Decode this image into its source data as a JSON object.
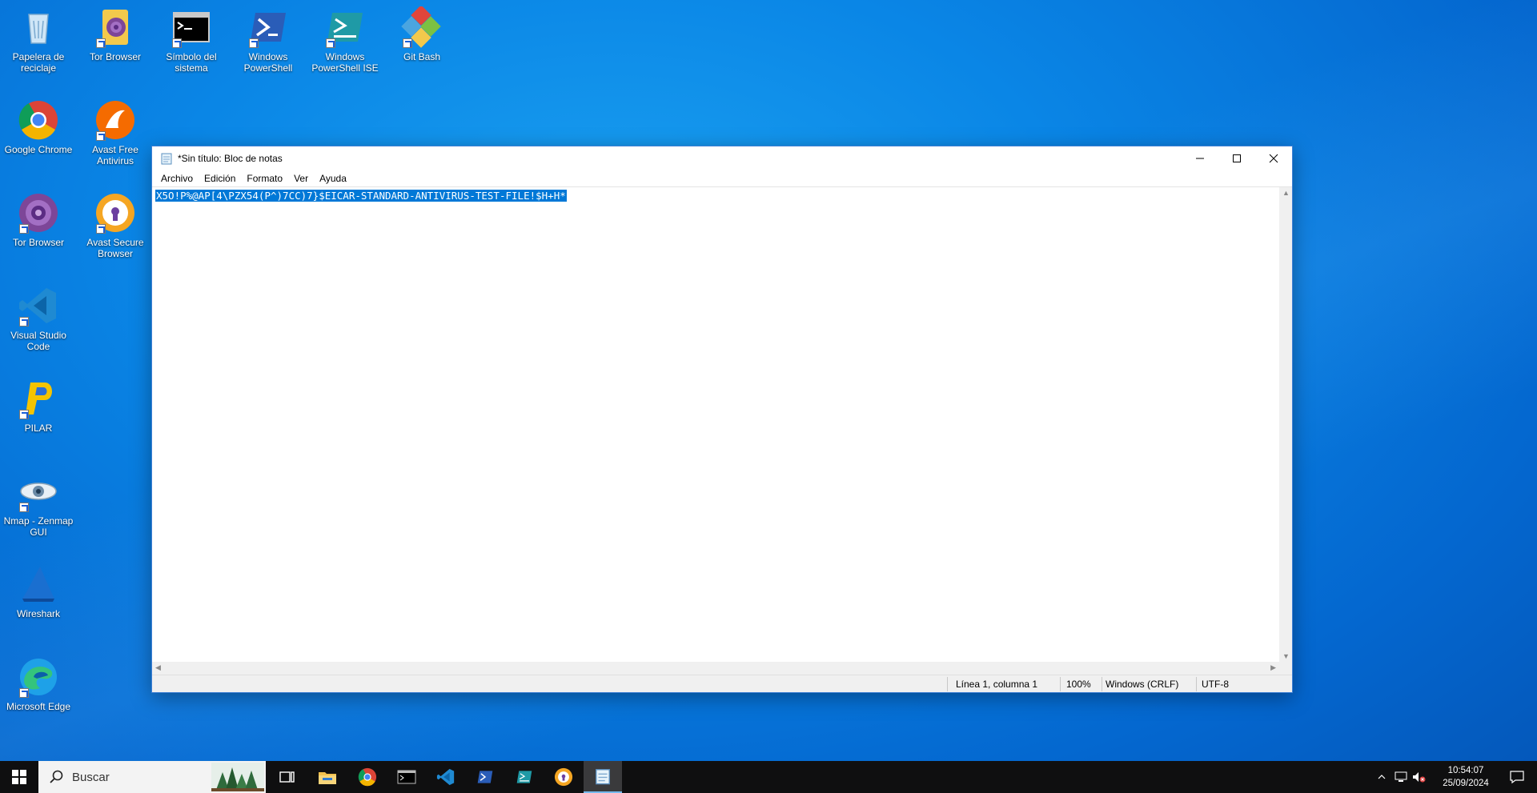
{
  "desktop": {
    "icons": [
      {
        "label": "Papelera de reciclaje",
        "icon": "recycle-bin-icon"
      },
      {
        "label": "Tor Browser",
        "icon": "tor-browser-icon"
      },
      {
        "label": "Símbolo del sistema",
        "icon": "command-prompt-icon"
      },
      {
        "label": "Windows PowerShell",
        "icon": "powershell-icon"
      },
      {
        "label": "Windows PowerShell ISE",
        "icon": "powershell-ise-icon"
      },
      {
        "label": "Git Bash",
        "icon": "git-bash-icon"
      },
      {
        "label": "Google Chrome",
        "icon": "chrome-icon"
      },
      {
        "label": "Avast Free Antivirus",
        "icon": "avast-icon"
      },
      {
        "label": "Tor Browser",
        "icon": "tor-browser-icon"
      },
      {
        "label": "Avast Secure Browser",
        "icon": "avast-secure-browser-icon"
      },
      {
        "label": "Visual Studio Code",
        "icon": "vscode-icon"
      },
      {
        "label": "PILAR",
        "icon": "pilar-icon"
      },
      {
        "label": "Nmap - Zenmap GUI",
        "icon": "nmap-icon"
      },
      {
        "label": "Wireshark",
        "icon": "wireshark-icon"
      },
      {
        "label": "Microsoft Edge",
        "icon": "edge-icon"
      }
    ]
  },
  "notepad": {
    "title": "*Sin título: Bloc de notas",
    "menu": [
      "Archivo",
      "Edición",
      "Formato",
      "Ver",
      "Ayuda"
    ],
    "content": "X5O!P%@AP[4\\PZX54(P^)7CC)7}$EICAR-STANDARD-ANTIVIRUS-TEST-FILE!$H+H*",
    "status": {
      "position": "Línea 1, columna 1",
      "zoom": "100%",
      "line_ending": "Windows (CRLF)",
      "encoding": "UTF-8"
    }
  },
  "taskbar": {
    "search_placeholder": "Buscar",
    "time": "10:54:07",
    "date": "25/09/2024",
    "apps": [
      "task-view-icon",
      "file-explorer-icon",
      "chrome-icon",
      "terminal-icon",
      "vscode-icon",
      "powershell-icon",
      "powershell-ise-icon",
      "avast-secure-browser-icon",
      "notepad-icon"
    ]
  },
  "colors": {
    "accent": "#0078d7",
    "taskbar": "#0f0f10"
  }
}
